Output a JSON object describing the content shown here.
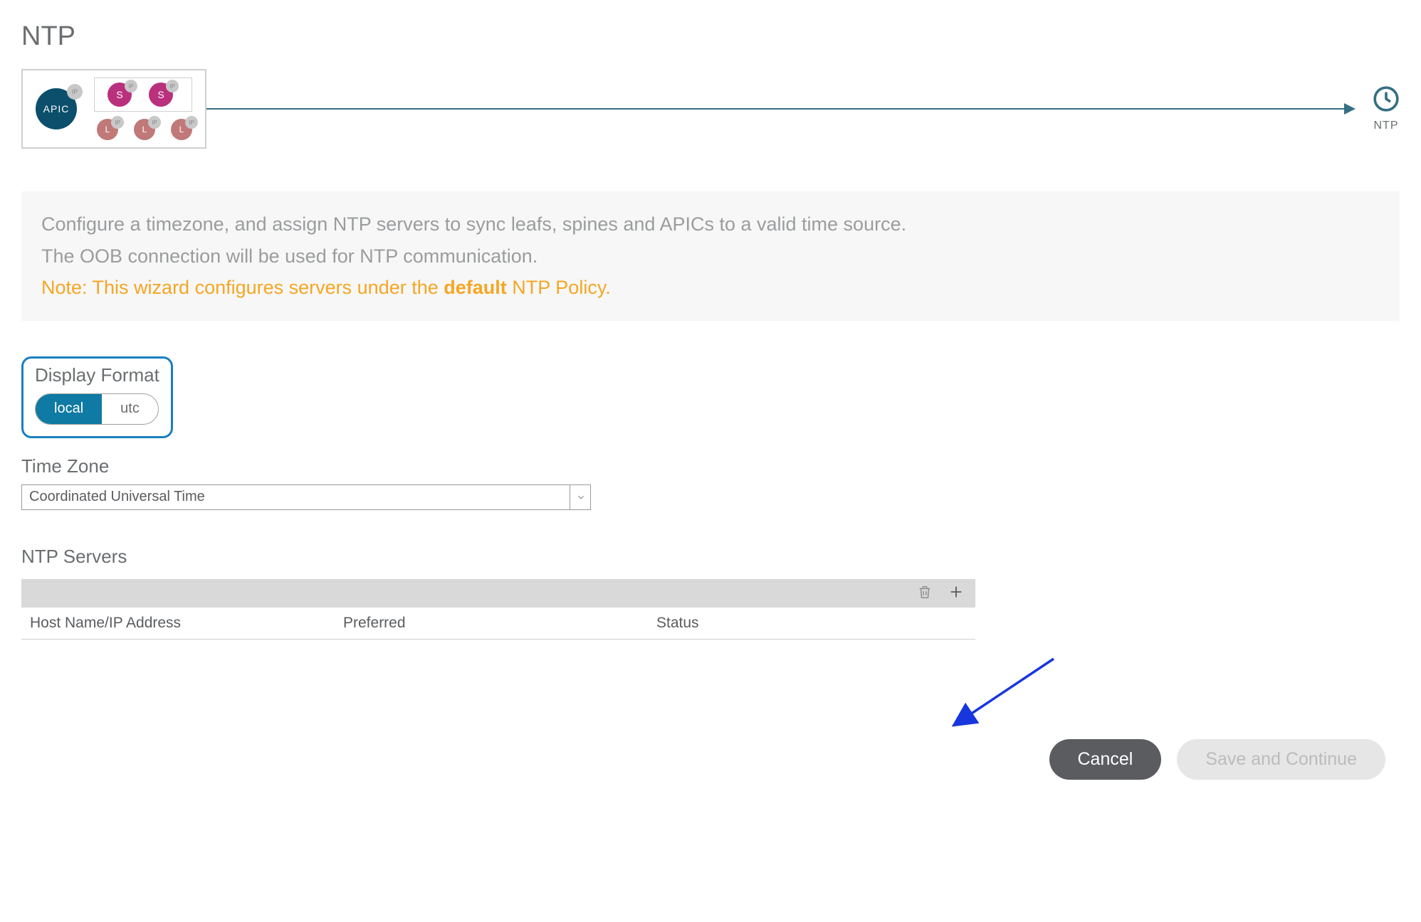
{
  "page": {
    "title": "NTP"
  },
  "topology": {
    "apic_label": "APIC",
    "ip_badge": "IP",
    "spine_labels": [
      "S",
      "S"
    ],
    "leaf_labels": [
      "L",
      "L",
      "L"
    ],
    "ntp_target_label": "NTP"
  },
  "info": {
    "line1": "Configure a timezone, and assign NTP servers to sync leafs, spines and APICs to a valid time source.",
    "line2": "The OOB connection will be used for NTP communication.",
    "note_prefix": "Note: This wizard configures servers under the ",
    "note_bold": "default",
    "note_suffix": " NTP Policy."
  },
  "display_format": {
    "label": "Display Format",
    "options": {
      "local": "local",
      "utc": "utc"
    },
    "selected": "local"
  },
  "time_zone": {
    "label": "Time Zone",
    "value": "Coordinated Universal Time"
  },
  "ntp_servers": {
    "label": "NTP Servers",
    "columns": {
      "host": "Host Name/IP Address",
      "preferred": "Preferred",
      "status": "Status"
    },
    "rows": []
  },
  "footer": {
    "cancel": "Cancel",
    "save": "Save and Continue"
  },
  "colors": {
    "accent": "#0f7aa3",
    "note": "#f5a623",
    "spine": "#b9307c",
    "leaf": "#c07878",
    "apic": "#0b4f6c"
  }
}
